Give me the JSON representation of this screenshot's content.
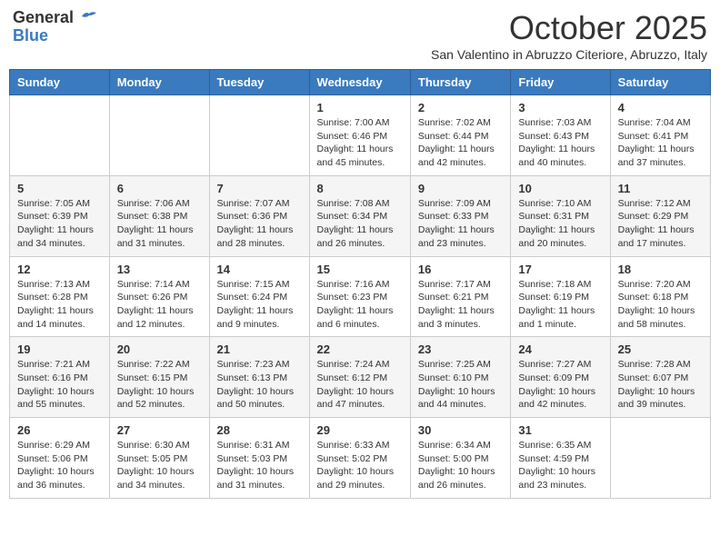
{
  "logo": {
    "general": "General",
    "blue": "Blue"
  },
  "title": "October 2025",
  "subtitle": "San Valentino in Abruzzo Citeriore, Abruzzo, Italy",
  "days_of_week": [
    "Sunday",
    "Monday",
    "Tuesday",
    "Wednesday",
    "Thursday",
    "Friday",
    "Saturday"
  ],
  "weeks": [
    [
      {
        "day": "",
        "info": ""
      },
      {
        "day": "",
        "info": ""
      },
      {
        "day": "",
        "info": ""
      },
      {
        "day": "1",
        "info": "Sunrise: 7:00 AM\nSunset: 6:46 PM\nDaylight: 11 hours and 45 minutes."
      },
      {
        "day": "2",
        "info": "Sunrise: 7:02 AM\nSunset: 6:44 PM\nDaylight: 11 hours and 42 minutes."
      },
      {
        "day": "3",
        "info": "Sunrise: 7:03 AM\nSunset: 6:43 PM\nDaylight: 11 hours and 40 minutes."
      },
      {
        "day": "4",
        "info": "Sunrise: 7:04 AM\nSunset: 6:41 PM\nDaylight: 11 hours and 37 minutes."
      }
    ],
    [
      {
        "day": "5",
        "info": "Sunrise: 7:05 AM\nSunset: 6:39 PM\nDaylight: 11 hours and 34 minutes."
      },
      {
        "day": "6",
        "info": "Sunrise: 7:06 AM\nSunset: 6:38 PM\nDaylight: 11 hours and 31 minutes."
      },
      {
        "day": "7",
        "info": "Sunrise: 7:07 AM\nSunset: 6:36 PM\nDaylight: 11 hours and 28 minutes."
      },
      {
        "day": "8",
        "info": "Sunrise: 7:08 AM\nSunset: 6:34 PM\nDaylight: 11 hours and 26 minutes."
      },
      {
        "day": "9",
        "info": "Sunrise: 7:09 AM\nSunset: 6:33 PM\nDaylight: 11 hours and 23 minutes."
      },
      {
        "day": "10",
        "info": "Sunrise: 7:10 AM\nSunset: 6:31 PM\nDaylight: 11 hours and 20 minutes."
      },
      {
        "day": "11",
        "info": "Sunrise: 7:12 AM\nSunset: 6:29 PM\nDaylight: 11 hours and 17 minutes."
      }
    ],
    [
      {
        "day": "12",
        "info": "Sunrise: 7:13 AM\nSunset: 6:28 PM\nDaylight: 11 hours and 14 minutes."
      },
      {
        "day": "13",
        "info": "Sunrise: 7:14 AM\nSunset: 6:26 PM\nDaylight: 11 hours and 12 minutes."
      },
      {
        "day": "14",
        "info": "Sunrise: 7:15 AM\nSunset: 6:24 PM\nDaylight: 11 hours and 9 minutes."
      },
      {
        "day": "15",
        "info": "Sunrise: 7:16 AM\nSunset: 6:23 PM\nDaylight: 11 hours and 6 minutes."
      },
      {
        "day": "16",
        "info": "Sunrise: 7:17 AM\nSunset: 6:21 PM\nDaylight: 11 hours and 3 minutes."
      },
      {
        "day": "17",
        "info": "Sunrise: 7:18 AM\nSunset: 6:19 PM\nDaylight: 11 hours and 1 minute."
      },
      {
        "day": "18",
        "info": "Sunrise: 7:20 AM\nSunset: 6:18 PM\nDaylight: 10 hours and 58 minutes."
      }
    ],
    [
      {
        "day": "19",
        "info": "Sunrise: 7:21 AM\nSunset: 6:16 PM\nDaylight: 10 hours and 55 minutes."
      },
      {
        "day": "20",
        "info": "Sunrise: 7:22 AM\nSunset: 6:15 PM\nDaylight: 10 hours and 52 minutes."
      },
      {
        "day": "21",
        "info": "Sunrise: 7:23 AM\nSunset: 6:13 PM\nDaylight: 10 hours and 50 minutes."
      },
      {
        "day": "22",
        "info": "Sunrise: 7:24 AM\nSunset: 6:12 PM\nDaylight: 10 hours and 47 minutes."
      },
      {
        "day": "23",
        "info": "Sunrise: 7:25 AM\nSunset: 6:10 PM\nDaylight: 10 hours and 44 minutes."
      },
      {
        "day": "24",
        "info": "Sunrise: 7:27 AM\nSunset: 6:09 PM\nDaylight: 10 hours and 42 minutes."
      },
      {
        "day": "25",
        "info": "Sunrise: 7:28 AM\nSunset: 6:07 PM\nDaylight: 10 hours and 39 minutes."
      }
    ],
    [
      {
        "day": "26",
        "info": "Sunrise: 6:29 AM\nSunset: 5:06 PM\nDaylight: 10 hours and 36 minutes."
      },
      {
        "day": "27",
        "info": "Sunrise: 6:30 AM\nSunset: 5:05 PM\nDaylight: 10 hours and 34 minutes."
      },
      {
        "day": "28",
        "info": "Sunrise: 6:31 AM\nSunset: 5:03 PM\nDaylight: 10 hours and 31 minutes."
      },
      {
        "day": "29",
        "info": "Sunrise: 6:33 AM\nSunset: 5:02 PM\nDaylight: 10 hours and 29 minutes."
      },
      {
        "day": "30",
        "info": "Sunrise: 6:34 AM\nSunset: 5:00 PM\nDaylight: 10 hours and 26 minutes."
      },
      {
        "day": "31",
        "info": "Sunrise: 6:35 AM\nSunset: 4:59 PM\nDaylight: 10 hours and 23 minutes."
      },
      {
        "day": "",
        "info": ""
      }
    ]
  ]
}
